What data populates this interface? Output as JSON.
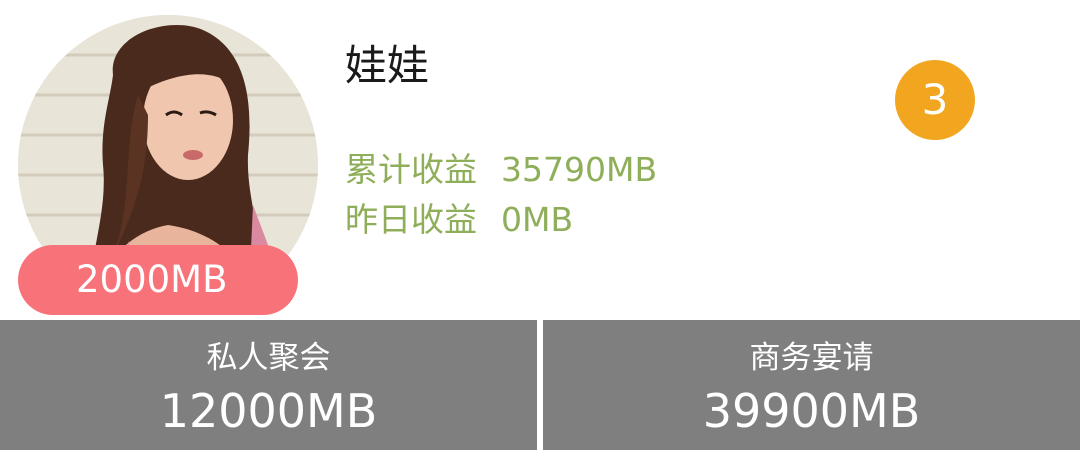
{
  "profile": {
    "name": "娃娃",
    "rank": "3",
    "badge_value": "2000MB",
    "total_earnings_label": "累计收益",
    "total_earnings_value": "35790MB",
    "yesterday_earnings_label": "昨日收益",
    "yesterday_earnings_value": "0MB"
  },
  "bottom": {
    "items": [
      {
        "label": "私人聚会",
        "value": "12000MB"
      },
      {
        "label": "商务宴请",
        "value": "39900MB"
      }
    ]
  },
  "colors": {
    "pill": "#f8727a",
    "rank_badge": "#f2a51e",
    "stat_text": "#8fae5a",
    "bottom_bar": "#7f7f7f"
  }
}
